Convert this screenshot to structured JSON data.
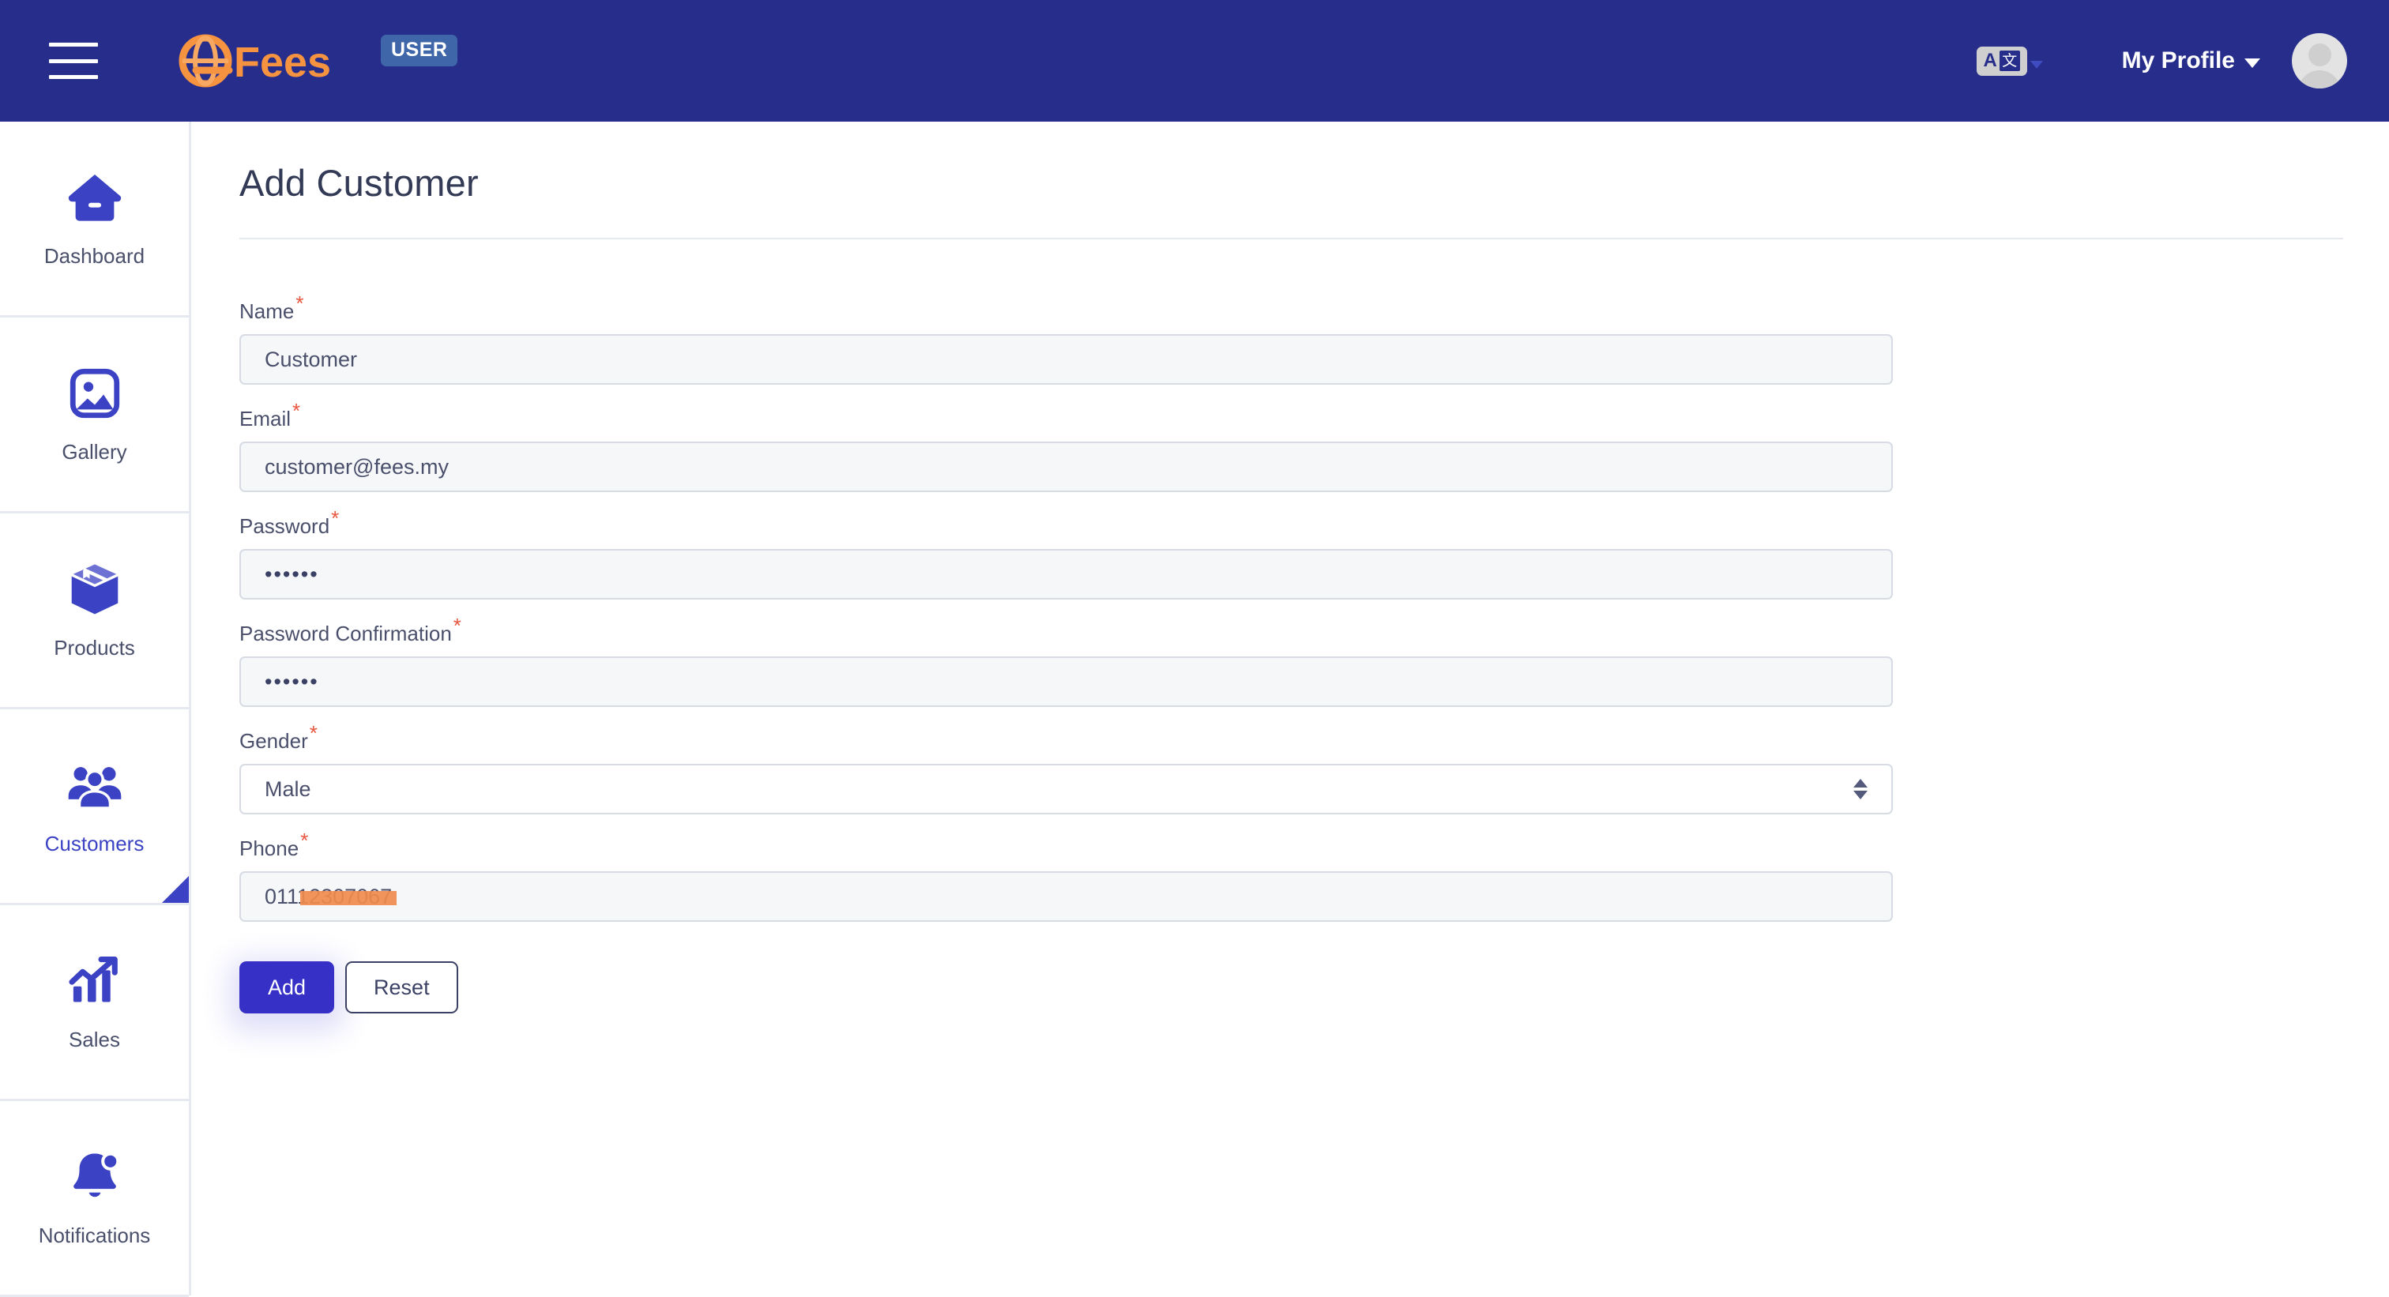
{
  "header": {
    "menu_icon": "hamburger-icon",
    "brand_name": "Fees",
    "badge_label": "USER",
    "translate_icon": "translate-icon",
    "translate_letter": "A",
    "translate_glyph": "文",
    "profile_label": "My Profile",
    "avatar_icon": "user-avatar-icon",
    "colors": {
      "topbar_bg": "#262d8b",
      "brand_orange": "#f59340",
      "badge_bg": "#3f66a8"
    }
  },
  "sidebar": {
    "items": [
      {
        "label": "Dashboard",
        "icon": "home-icon",
        "active": false
      },
      {
        "label": "Gallery",
        "icon": "image-icon",
        "active": false
      },
      {
        "label": "Products",
        "icon": "box-icon",
        "active": false
      },
      {
        "label": "Customers",
        "icon": "people-icon",
        "active": true
      },
      {
        "label": "Sales",
        "icon": "chart-up-icon",
        "active": false
      },
      {
        "label": "Notifications",
        "icon": "bell-icon",
        "active": false
      }
    ],
    "active_color": "#3b42c4",
    "inactive_color": "#4a4f6b"
  },
  "main": {
    "page_title": "Add Customer",
    "required_marker": "*",
    "fields": [
      {
        "label": "Name",
        "value": "Customer",
        "type": "text",
        "required": true
      },
      {
        "label": "Email",
        "value": "customer@fees.my",
        "type": "email",
        "required": true
      },
      {
        "label": "Password",
        "value": "••••••",
        "type": "password",
        "required": true
      },
      {
        "label": "Password Confirmation",
        "value": "••••••",
        "type": "password",
        "required": true
      },
      {
        "label": "Gender",
        "value": "Male",
        "type": "select",
        "required": true
      },
      {
        "label": "Phone",
        "value": "01112307067",
        "type": "tel",
        "required": true
      }
    ],
    "buttons": {
      "submit_label": "Add",
      "reset_label": "Reset"
    },
    "colors": {
      "primary_button": "#3730c7",
      "required_asterisk": "#e8563f",
      "input_bg": "#f6f7f9",
      "input_border": "#d6dbe4",
      "redaction": "#ef8b4e"
    }
  }
}
